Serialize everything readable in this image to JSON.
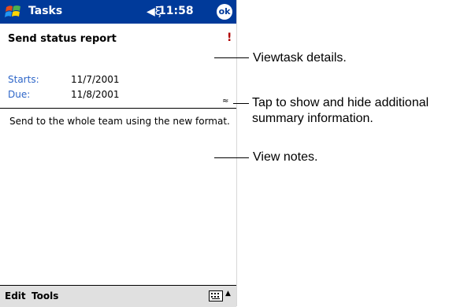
{
  "titlebar": {
    "app_title": "Tasks",
    "speaker_icon": "◀ξ",
    "time": "11:58",
    "ok_label": "ok"
  },
  "task": {
    "subject": "Send status report",
    "priority_marker": "!",
    "starts_label": "Starts:",
    "starts_value": "11/7/2001",
    "due_label": "Due:",
    "due_value": "11/8/2001",
    "toggle_symbol": "≈",
    "notes": "Send to the whole team using the new format."
  },
  "menubar": {
    "edit": "Edit",
    "tools": "Tools",
    "sip_arrow": "▲"
  },
  "callouts": {
    "details": "Viewtask details.",
    "toggle_line1": "Tap to show and hide additional",
    "toggle_line2": "summary information.",
    "notes": "View notes."
  },
  "colors": {
    "titlebar": "#003A9A",
    "label_blue": "#2E66C8",
    "priority_red": "#B00000"
  },
  "icons": {
    "start": "windows-flag-icon",
    "speaker": "speaker-icon",
    "keyboard": "keyboard-icon"
  }
}
